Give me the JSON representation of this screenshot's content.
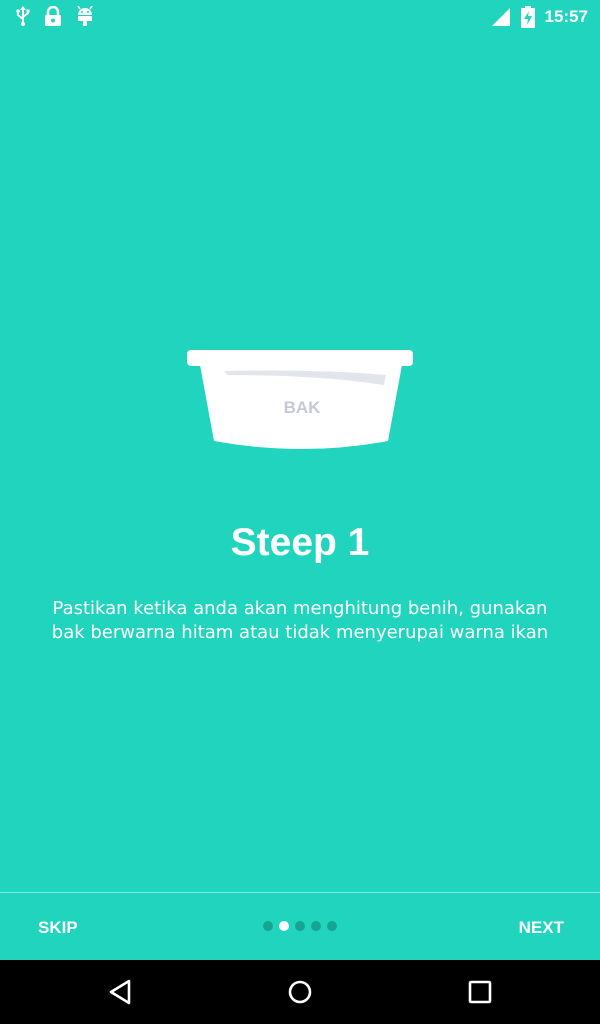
{
  "status_bar": {
    "time": "15:57",
    "icons_left": [
      "usb-icon",
      "lock-icon",
      "android-icon"
    ],
    "icons_right": [
      "signal-icon",
      "battery-charging-icon"
    ]
  },
  "illustration": {
    "label": "BAK",
    "icon": "basin-icon"
  },
  "onboarding": {
    "title": "Steep 1",
    "description": "Pastikan ketika anda akan menghitung benih, gunakan bak berwarna hitam atau tidak menyerupai warna ikan",
    "page_count": 5,
    "active_page": 2
  },
  "bottom_nav": {
    "skip_label": "SKIP",
    "next_label": "NEXT"
  },
  "nav_bar": {
    "icons": [
      "back-icon",
      "home-icon",
      "recents-icon"
    ]
  },
  "colors": {
    "background": "#21d4be",
    "dot_inactive": "#17a493",
    "dot_active": "#ffffff",
    "nav_bar": "#000000"
  }
}
